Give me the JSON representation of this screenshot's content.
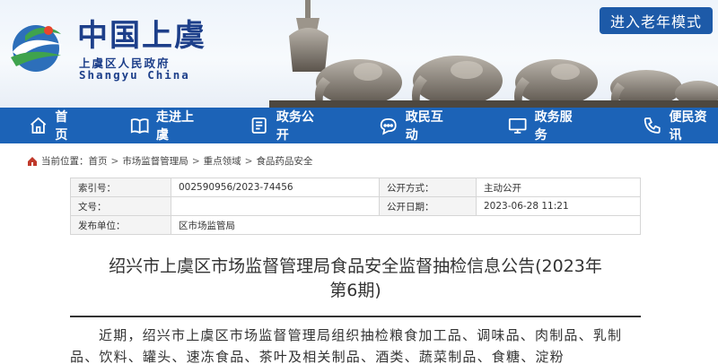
{
  "header": {
    "logo_title": "中国上虞",
    "logo_subtitle": "上虞区人民政府",
    "logo_english": "Shangyu China",
    "elder_mode_label": "进入老年模式"
  },
  "nav": {
    "items": [
      {
        "label": "首页",
        "icon": "home-icon"
      },
      {
        "label": "走进上虞",
        "icon": "book-icon"
      },
      {
        "label": "政务公开",
        "icon": "document-icon"
      },
      {
        "label": "政民互动",
        "icon": "chat-icon"
      },
      {
        "label": "政务服务",
        "icon": "monitor-icon"
      },
      {
        "label": "便民资讯",
        "icon": "phone-icon"
      }
    ]
  },
  "breadcrumb": {
    "prefix": "当前位置：",
    "items": [
      "首页",
      "市场监督管理局",
      "重点领域",
      "食品药品安全"
    ]
  },
  "meta": {
    "index_label": "索引号：",
    "index_value": "002590956/2023-74456",
    "open_mode_label": "公开方式：",
    "open_mode_value": "主动公开",
    "doc_no_label": "文号：",
    "doc_no_value": "",
    "open_date_label": "公开日期：",
    "open_date_value": "2023-06-28 11:21",
    "publisher_label": "发布单位：",
    "publisher_value": "区市场监管局"
  },
  "article": {
    "title_line1": "绍兴市上虞区市场监督管理局食品安全监督抽检信息公告(2023年",
    "title_line2": "第6期)",
    "body": "近期，绍兴市上虞区市场监督管理局组织抽检粮食加工品、调味品、肉制品、乳制品、饮料、罐头、速冻食品、茶叶及相关制品、酒类、蔬菜制品、食糖、淀粉"
  },
  "colors": {
    "nav_bg": "#1c63b7",
    "elder_button_bg": "#1d5aa8",
    "logo_blue": "#1d3f8a"
  }
}
